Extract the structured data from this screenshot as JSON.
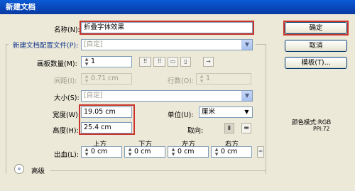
{
  "window": {
    "title": "新建文档"
  },
  "fields": {
    "name_label": "名称(N):",
    "name_value": "折叠字体效果",
    "profile_label": "新建文档配置文件(P):",
    "profile_value": "[自定]",
    "artboard_count_label": "画板数量(M):",
    "artboard_count_value": "1",
    "spacing_label": "间距(I):",
    "spacing_value": "0.71 cm",
    "columns_label": "行数(O):",
    "columns_value": "1",
    "size_label": "大小(S):",
    "size_value": "[自定]",
    "width_label": "宽度(W):",
    "width_value": "19.05 cm",
    "height_label": "高度(H):",
    "height_value": "25.4 cm",
    "units_label": "单位(U):",
    "units_value": "厘米",
    "orientation_label": "取向:",
    "bleed_label": "出血(L):",
    "bleed_top_label": "上方",
    "bleed_bottom_label": "下方",
    "bleed_left_label": "左方",
    "bleed_right_label": "右方",
    "bleed_top_value": "0 cm",
    "bleed_bottom_value": "0 cm",
    "bleed_left_value": "0 cm",
    "bleed_right_value": "0 cm",
    "advanced_label": "高级"
  },
  "buttons": {
    "ok": "确定",
    "cancel": "取消",
    "templates": "模板(T)..."
  },
  "info": {
    "color_mode": "颜色模式:RGB",
    "ppi": "PPI:72"
  },
  "icons": {
    "grid_by_row": "grid-by-row-icon",
    "grid_by_column": "grid-by-column-icon",
    "arrange_by_row": "arrange-by-row-icon",
    "arrange_by_column": "arrange-by-column-icon",
    "right_to_left": "right-to-left-icon",
    "portrait": "portrait-icon",
    "landscape": "landscape-icon",
    "link": "link-icon",
    "expand": "expand-icon"
  },
  "colors": {
    "title_bar": "#0a50c8",
    "highlight": "#c8332b",
    "dialog_bg": "#ece9d8"
  }
}
